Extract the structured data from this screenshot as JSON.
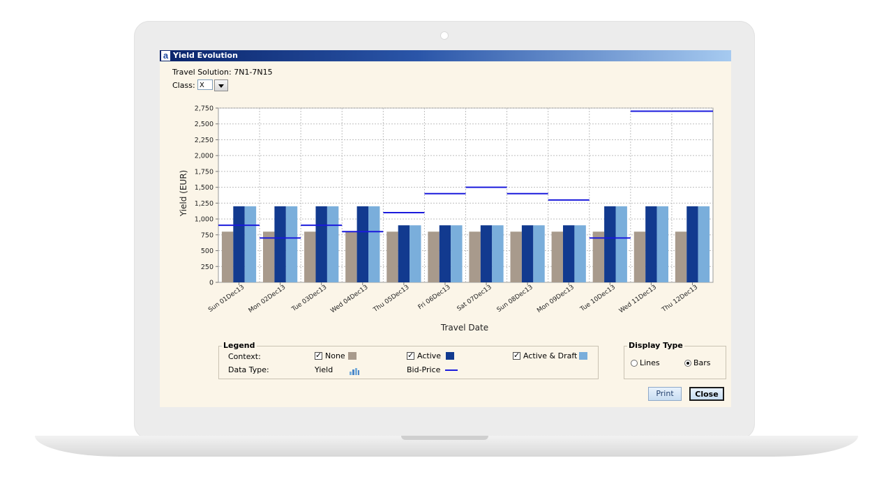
{
  "window": {
    "title": "Yield Evolution",
    "app_icon_letter": "a"
  },
  "travel_solution": {
    "label": "Travel Solution:",
    "value": "7N1-7N15"
  },
  "class_select": {
    "label": "Class:",
    "value": "X"
  },
  "chart_data": {
    "type": "bar",
    "xlabel": "Travel Date",
    "ylabel": "Yield (EUR)",
    "ylim": [
      0,
      2750
    ],
    "yticks": [
      0,
      250,
      500,
      750,
      1000,
      1250,
      1500,
      1750,
      2000,
      2250,
      2500,
      2750
    ],
    "ytick_labels": [
      "0",
      "250",
      "500",
      "750",
      "1,000",
      "1,250",
      "1,500",
      "1,750",
      "2,000",
      "2,250",
      "2,500",
      "2,750"
    ],
    "grid": true,
    "categories": [
      "Sun 01Dec13",
      "Mon 02Dec13",
      "Tue 03Dec13",
      "Wed 04Dec13",
      "Thu 05Dec13",
      "Fri 06Dec13",
      "Sat 07Dec13",
      "Sun 08Dec13",
      "Mon 09Dec13",
      "Tue 10Dec13",
      "Wed 11Dec13",
      "Thu 12Dec13"
    ],
    "series": [
      {
        "name": "None",
        "color": "#a89a8c",
        "values": [
          800,
          800,
          800,
          800,
          800,
          800,
          800,
          800,
          800,
          800,
          800,
          800
        ]
      },
      {
        "name": "Active",
        "color": "#123a8f",
        "values": [
          1200,
          1200,
          1200,
          1200,
          900,
          900,
          900,
          900,
          900,
          1200,
          1200,
          1200
        ]
      },
      {
        "name": "Active & Draft",
        "color": "#7aaedb",
        "values": [
          1200,
          1200,
          1200,
          1200,
          900,
          900,
          900,
          900,
          900,
          1200,
          1200,
          1200
        ]
      }
    ],
    "bid_price": {
      "name": "Bid-Price",
      "color": "#1a1adc",
      "values": [
        900,
        700,
        900,
        800,
        1100,
        1400,
        1500,
        1400,
        1300,
        700,
        2700,
        2700
      ]
    }
  },
  "legend": {
    "title": "Legend",
    "context_label": "Context:",
    "items": [
      {
        "label": "None",
        "checked": true,
        "color": "#a89a8c"
      },
      {
        "label": "Active",
        "checked": true,
        "color": "#123a8f"
      },
      {
        "label": "Active & Draft",
        "checked": true,
        "color": "#7aaedb"
      }
    ],
    "data_type_label": "Data Type:",
    "yield_label": "Yield",
    "bid_price_label": "Bid-Price"
  },
  "display_type": {
    "title": "Display Type",
    "lines_label": "Lines",
    "bars_label": "Bars",
    "selected": "Bars"
  },
  "buttons": {
    "print": "Print",
    "close": "Close"
  }
}
